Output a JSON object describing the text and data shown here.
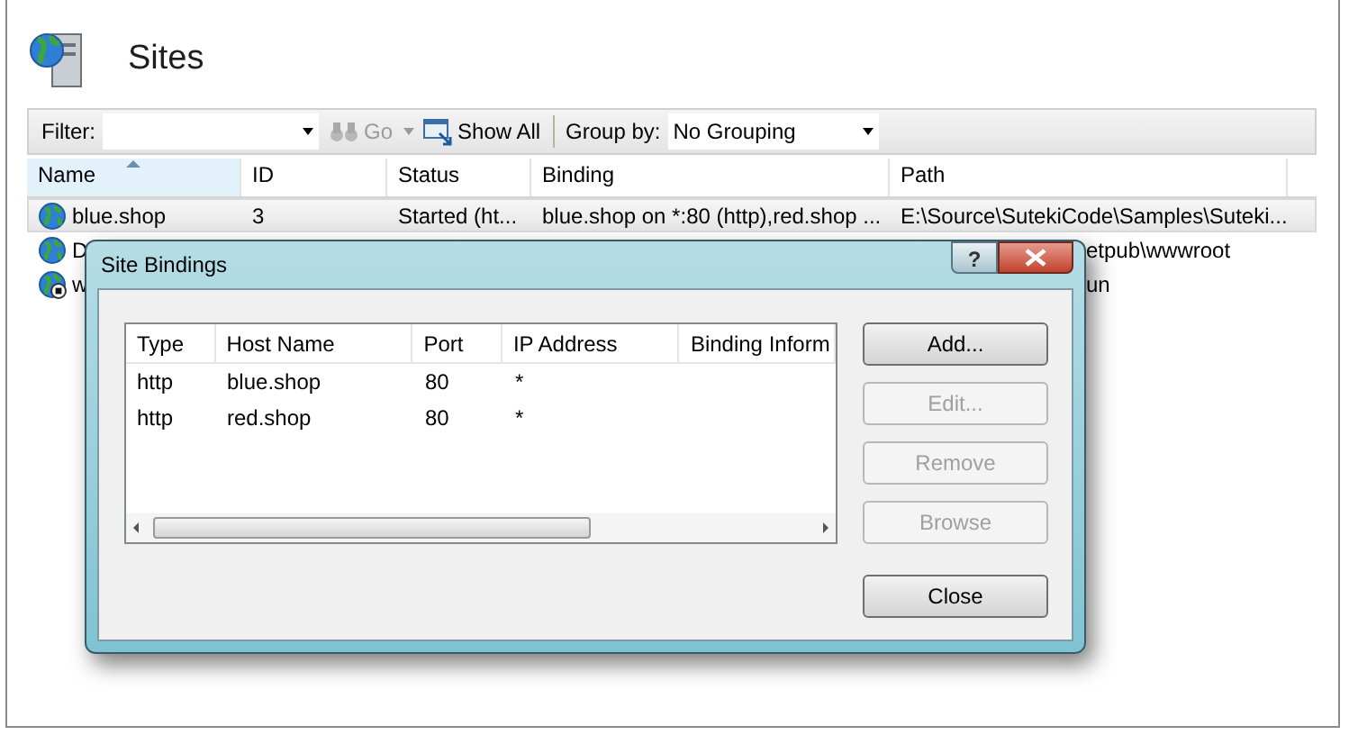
{
  "header": {
    "title": "Sites"
  },
  "toolbar": {
    "filter_label": "Filter:",
    "go": {
      "label": "Go",
      "disabled": true
    },
    "show_all": "Show All",
    "group_by_label": "Group by:",
    "group_by_value": "No Grouping"
  },
  "table": {
    "columns": [
      {
        "label": "Name",
        "sorted": true
      },
      {
        "label": "ID",
        "sorted": false
      },
      {
        "label": "Status",
        "sorted": false
      },
      {
        "label": "Binding",
        "sorted": false
      },
      {
        "label": "Path",
        "sorted": false
      }
    ],
    "rows": [
      {
        "name": "blue.shop",
        "id": "3",
        "status": "Started (ht...",
        "binding": "blue.shop on *:80 (http),red.shop ...",
        "path": "E:\\Source\\SutekiCode\\Samples\\Suteki...",
        "selected": true,
        "stopped": false
      },
      {
        "name": "D",
        "id": "",
        "status": "",
        "binding": "",
        "path": "etpub\\wwwroot",
        "selected": false,
        "stopped": false
      },
      {
        "name": "w",
        "id": "",
        "status": "",
        "binding": "",
        "path": "un",
        "selected": false,
        "stopped": true
      }
    ]
  },
  "dialog": {
    "title": "Site Bindings",
    "help": "?",
    "columns": [
      "Type",
      "Host Name",
      "Port",
      "IP Address",
      "Binding Inform"
    ],
    "rows": [
      [
        "http",
        "blue.shop",
        "80",
        "*"
      ],
      [
        "http",
        "red.shop",
        "80",
        "*"
      ]
    ],
    "buttons": [
      {
        "label": "Add...",
        "disabled": false
      },
      {
        "label": "Edit...",
        "disabled": true
      },
      {
        "label": "Remove",
        "disabled": true
      },
      {
        "label": "Browse",
        "disabled": true
      }
    ],
    "close": "Close"
  }
}
